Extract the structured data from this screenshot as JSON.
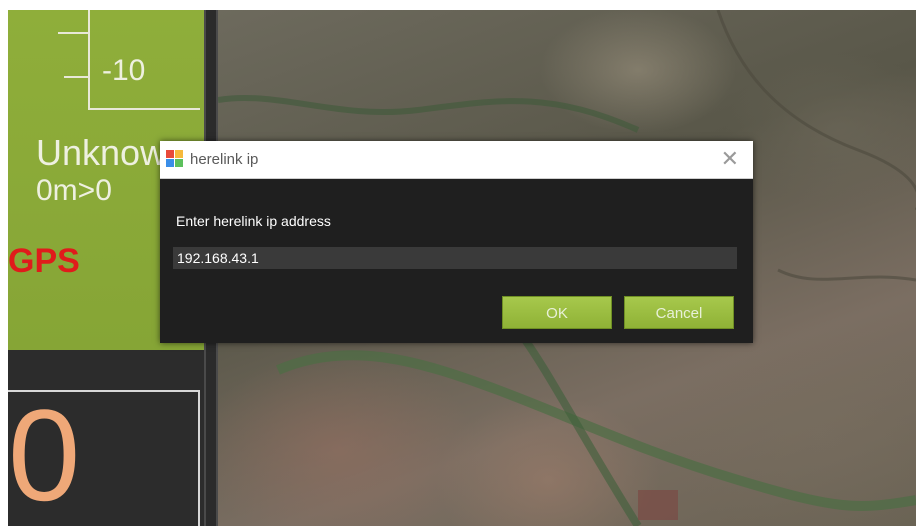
{
  "hud": {
    "altitude_tick_label": "-10",
    "flight_mode": "Unknow",
    "distance": "0m>0",
    "gps_status": "GPS",
    "big_value": "0"
  },
  "dialog": {
    "title": "herelink ip",
    "close_glyph": "✕",
    "prompt": "Enter herelink ip address",
    "ip_value": "192.168.43.1",
    "ok_label": "OK",
    "cancel_label": "Cancel"
  },
  "colors": {
    "hud_green": "#8fae3a",
    "button_green": "#a7c84c",
    "gps_red": "#e01b1b",
    "dialog_bg": "#1f1f1f",
    "big_value_orange": "#efa878"
  },
  "icons": [
    "app-icon",
    "close-icon"
  ]
}
